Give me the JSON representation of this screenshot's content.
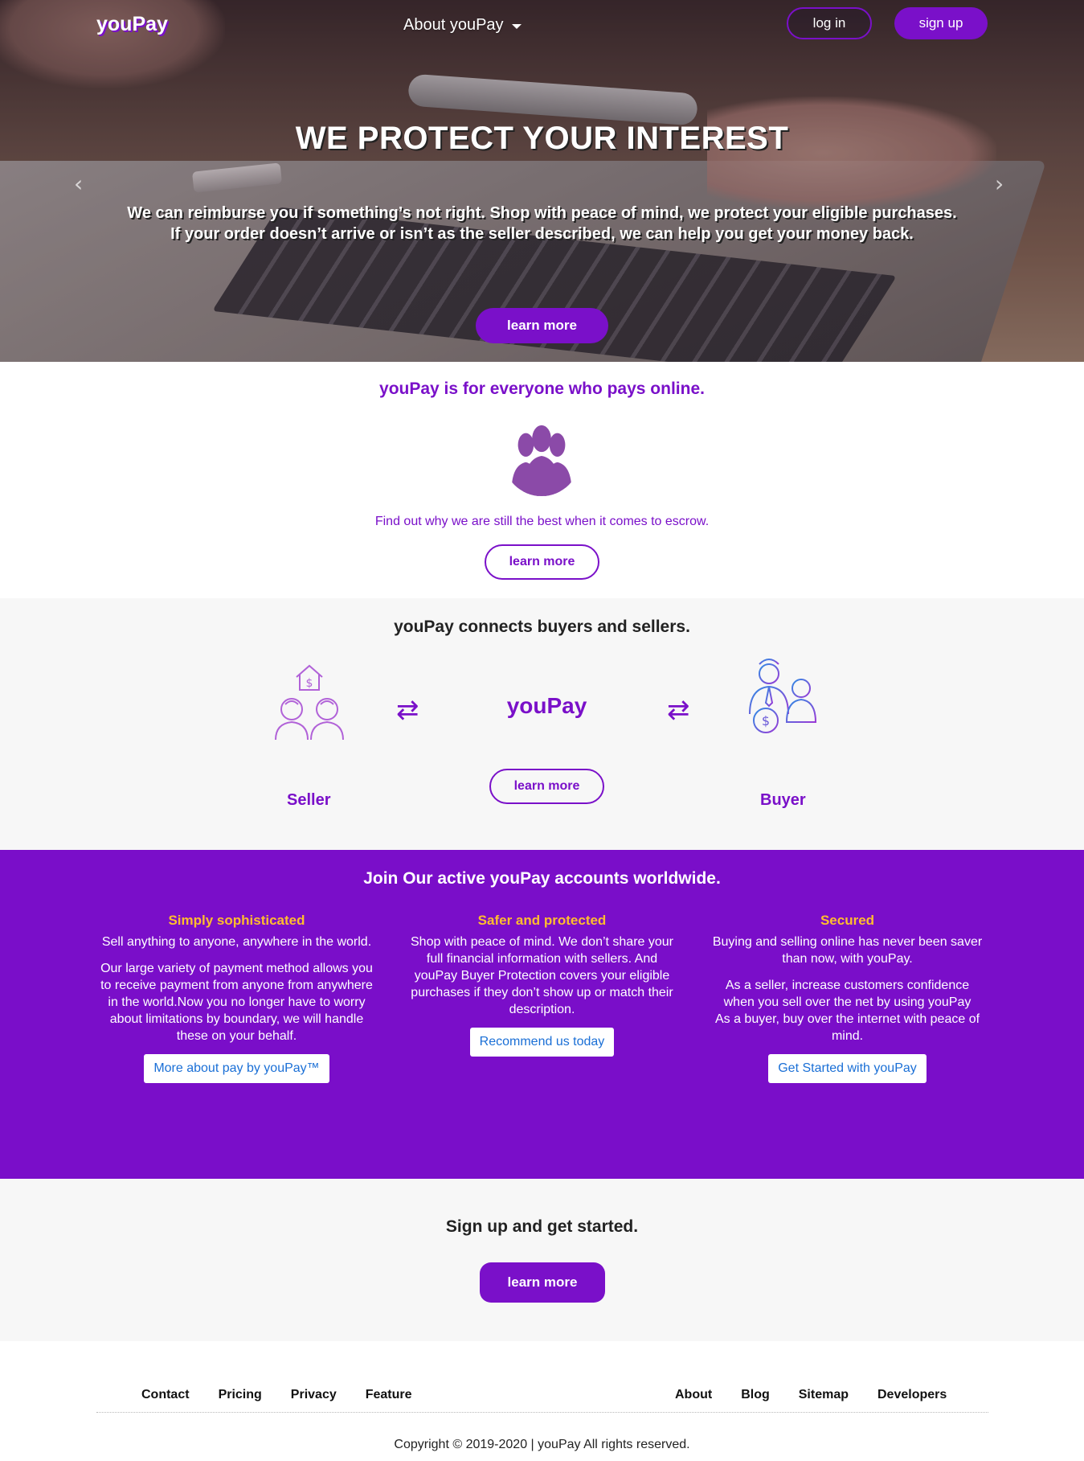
{
  "nav": {
    "brand": "youPay",
    "about_menu": "About youPay",
    "login": "log in",
    "signup": "sign up"
  },
  "hero": {
    "title": "WE PROTECT YOUR INTEREST",
    "text_line1": "We can reimburse you if something’s not right. Shop with peace of mind, we protect your eligible purchases.",
    "text_line2": "If your order doesn’t arrive or isn’t as the seller described, we can help you get your money back.",
    "prev_arrow": "‹",
    "next_arrow": "›",
    "cta": "learn more"
  },
  "everyone": {
    "title": "youPay is for everyone who pays online.",
    "icon": "group-icon",
    "text": "Find out why we are still the best when it comes to escrow.",
    "cta": "learn more"
  },
  "connects": {
    "title": "youPay connects buyers and sellers.",
    "brand": "youPay",
    "cta": "learn more",
    "seller_label": "Seller",
    "buyer_label": "Buyer",
    "swap_glyph": "⇄"
  },
  "join": {
    "title": "Join Our active youPay accounts worldwide.",
    "columns": [
      {
        "heading": "Simply sophisticated",
        "p1": "Sell anything to anyone, anywhere in the world.",
        "p2": "Our large variety of payment method allows you to receive payment from anyone from anywhere in the world.Now you no longer have to worry about limitations by boundary, we will handle these on your behalf.",
        "button": "More about pay by youPay™"
      },
      {
        "heading": "Safer and protected",
        "p1": "Shop with peace of mind. We don’t share your full financial information with sellers. And youPay Buyer Protection covers your eligible purchases if they don’t show up or match their description.",
        "button": "Recommend us today"
      },
      {
        "heading": "Secured",
        "p1": "Buying and selling online has never been saver than now, with youPay.",
        "p2": "As a seller, increase customers confidence when you sell over the net by using youPay",
        "p3": "As a buyer, buy over the internet with peace of mind.",
        "button": "Get Started with youPay"
      }
    ]
  },
  "signup": {
    "title": "Sign up and get started.",
    "cta": "learn more"
  },
  "footer": {
    "left_links": [
      "Contact",
      "Pricing",
      "Privacy",
      "Feature"
    ],
    "right_links": [
      "About",
      "Blog",
      "Sitemap",
      "Developers"
    ],
    "copyright": "Copyright © 2019-2020 | youPay All rights reserved."
  },
  "colors": {
    "brand_purple": "#7a10c9",
    "accent_yellow": "#ffbd2e",
    "link_blue": "#1a6fd6"
  }
}
